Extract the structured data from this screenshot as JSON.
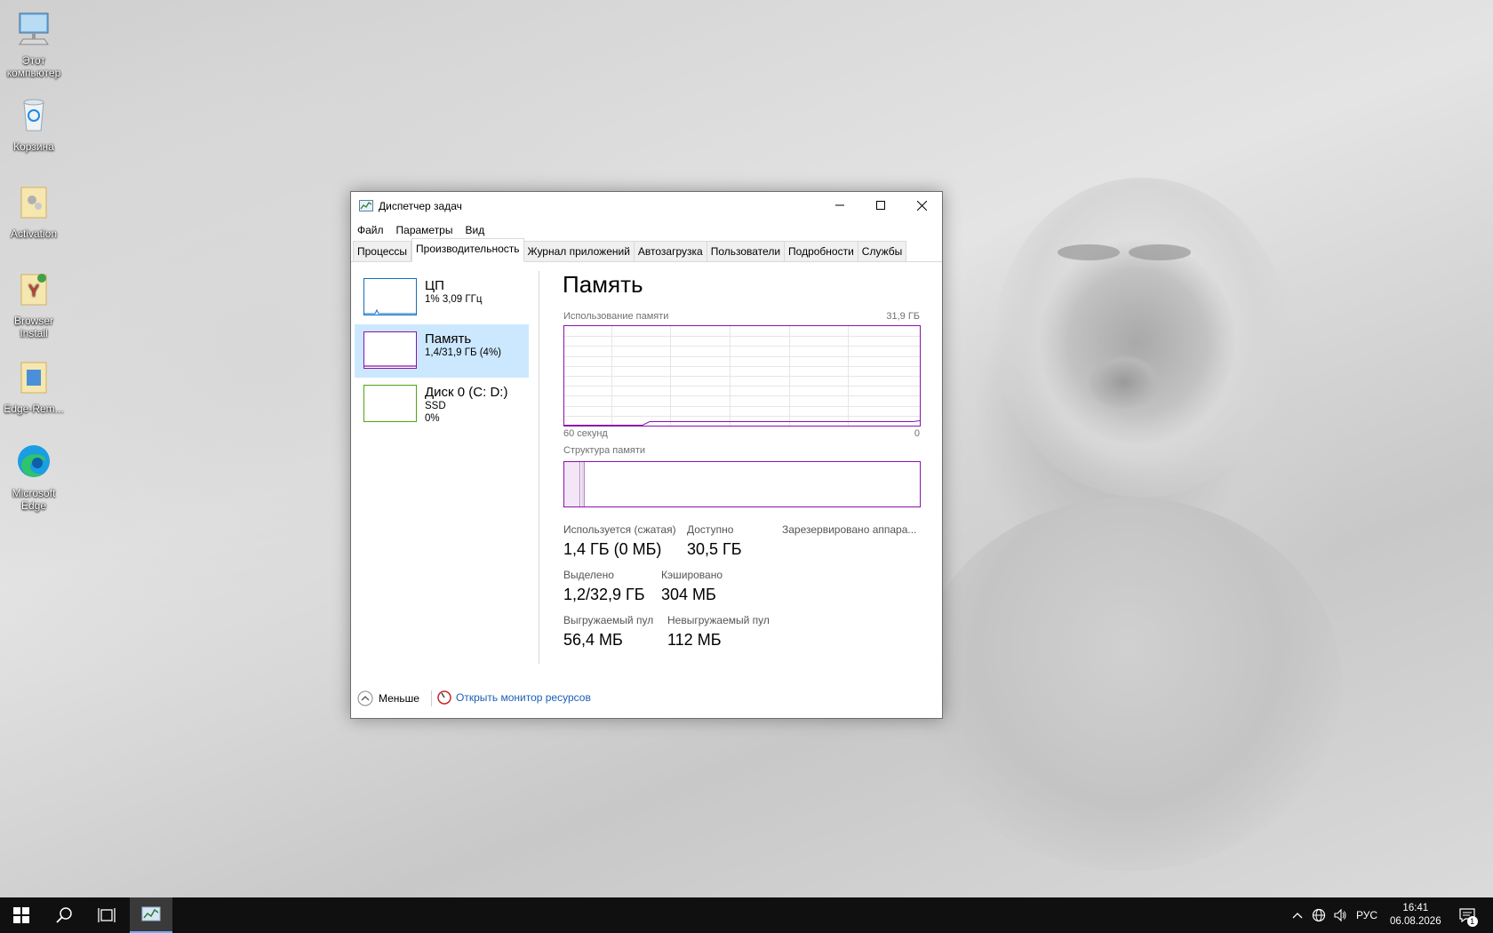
{
  "desktop": {
    "icons": [
      {
        "label": "Этот компьютер"
      },
      {
        "label": "Корзина"
      },
      {
        "label": "Activation"
      },
      {
        "label": "Browser Install"
      },
      {
        "label": "Edge-Rem..."
      },
      {
        "label": "Microsoft Edge"
      }
    ]
  },
  "window": {
    "title": "Диспетчер задач",
    "menu": [
      "Файл",
      "Параметры",
      "Вид"
    ],
    "tabs": [
      "Процессы",
      "Производительность",
      "Журнал приложений",
      "Автозагрузка",
      "Пользователи",
      "Подробности",
      "Службы"
    ],
    "active_tab": "Производительность",
    "sidebar": [
      {
        "name": "ЦП",
        "sub1": "1% 3,09 ГГц",
        "sub2": "",
        "color": "#1170c4"
      },
      {
        "name": "Память",
        "sub1": "1,4/31,9 ГБ (4%)",
        "sub2": "",
        "color": "#8b12ae"
      },
      {
        "name": "Диск 0 (C: D:)",
        "sub1": "SSD",
        "sub2": "0%",
        "color": "#4da60c"
      }
    ],
    "memory": {
      "title": "Память",
      "usage_label": "Использование памяти",
      "usage_max": "31,9 ГБ",
      "time_left": "60 секунд",
      "time_right": "0",
      "structure_label": "Структура памяти",
      "in_use_label": "Используется (сжатая)",
      "in_use_value": "1,4 ГБ (0 МБ)",
      "available_label": "Доступно",
      "available_value": "30,5 ГБ",
      "reserved_label": "Зарезервировано аппара...",
      "committed_label": "Выделено",
      "committed_value": "1,2/32,9 ГБ",
      "cached_label": "Кэшировано",
      "cached_value": "304 МБ",
      "paged_label": "Выгружаемый пул",
      "paged_value": "56,4 МБ",
      "nonpaged_label": "Невыгружаемый пул",
      "nonpaged_value": "112 МБ",
      "usage_percent": 4
    },
    "footer": {
      "less_label": "Меньше",
      "monitor_link": "Открыть монитор ресурсов"
    }
  },
  "taskbar": {
    "language": "РУС",
    "time": "16:41",
    "date": "06.08.2026",
    "notification_count": "1"
  }
}
